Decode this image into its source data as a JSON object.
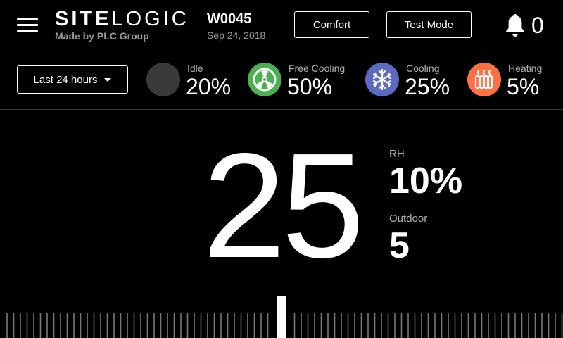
{
  "header": {
    "menu_icon": "hamburger-menu-icon",
    "logo_bold": "SITE",
    "logo_thin": "LOGIC",
    "logo_sub": "Made by PLC Group",
    "unit_id": "W0045",
    "unit_date": "Sep 24, 2018",
    "comfort_label": "Comfort",
    "test_mode_label": "Test Mode",
    "bell_icon": "bell-icon",
    "alarm_count": "0"
  },
  "stats": {
    "range_label": "Last 24 hours",
    "items": [
      {
        "label": "Idle",
        "value": "20%",
        "icon": "idle-circle",
        "color": "#3a3a3a"
      },
      {
        "label": "Free Cooling",
        "value": "50%",
        "icon": "fan-icon",
        "color": "#4caf50"
      },
      {
        "label": "Cooling",
        "value": "25%",
        "icon": "snowflake-icon",
        "color": "#5c6bc0"
      },
      {
        "label": "Heating",
        "value": "5%",
        "icon": "heater-icon",
        "color": "#ff7043"
      }
    ]
  },
  "main": {
    "setpoint": "25",
    "rh_label": "RH",
    "rh_value": "10%",
    "outdoor_label": "Outdoor",
    "outdoor_value": "5"
  },
  "colors": {
    "background": "#000000",
    "text": "#ffffff",
    "muted": "#9a9a9a",
    "divider": "#3a3a3a"
  }
}
